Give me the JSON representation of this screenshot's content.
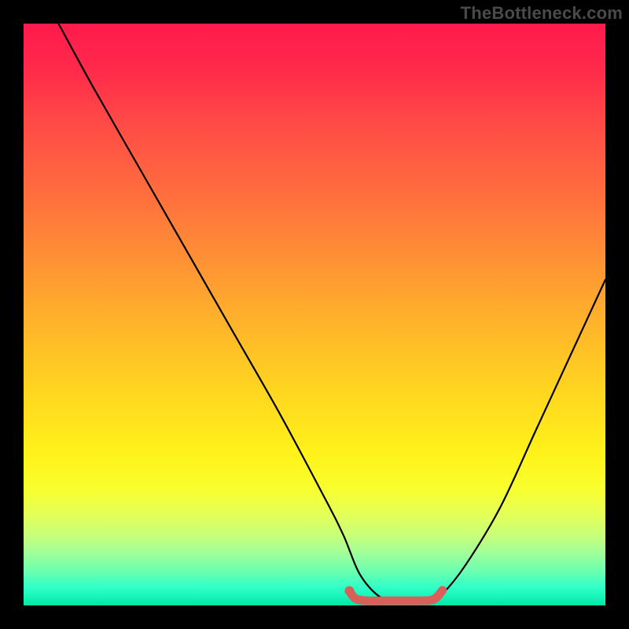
{
  "watermark": "TheBottleneck.com",
  "chart_data": {
    "type": "line",
    "title": "",
    "xlabel": "",
    "ylabel": "",
    "xlim": [
      0,
      100
    ],
    "ylim": [
      0,
      100
    ],
    "grid": false,
    "legend": false,
    "series": [
      {
        "name": "bottleneck-curve",
        "color": "#000000",
        "x": [
          6,
          12,
          20,
          28,
          36,
          44,
          52,
          55,
          58,
          62,
          66,
          70,
          72,
          76,
          82,
          88,
          94,
          100
        ],
        "y": [
          100,
          89,
          75,
          61,
          47,
          33,
          18,
          12,
          5,
          1,
          1,
          1,
          2,
          7,
          17,
          30,
          43,
          56
        ]
      },
      {
        "name": "optimal-range-marker",
        "color": "#d9605a",
        "x": [
          56,
          57,
          59,
          62,
          65,
          68,
          70,
          71,
          72
        ],
        "y": [
          2.5,
          1.2,
          0.8,
          0.8,
          0.8,
          0.8,
          0.9,
          1.4,
          2.6
        ]
      }
    ],
    "markers": [
      {
        "name": "optimal-start-dot",
        "x": 56,
        "y": 2.5,
        "color": "#d9605a"
      }
    ],
    "background_gradient": {
      "top": "#ff1a4d",
      "mid": "#ffe11a",
      "bottom": "#00e8a8"
    }
  }
}
